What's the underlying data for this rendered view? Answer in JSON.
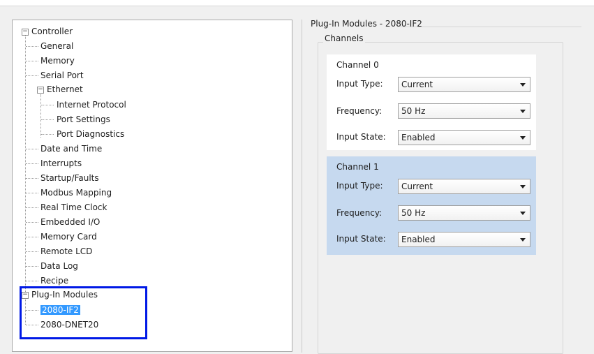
{
  "tree": {
    "controller": "Controller",
    "controller_children": [
      "General",
      "Memory",
      "Serial Port"
    ],
    "ethernet": "Ethernet",
    "ethernet_children": [
      "Internet Protocol",
      "Port Settings",
      "Port Diagnostics"
    ],
    "controller_rest": [
      "Date and Time",
      "Interrupts",
      "Startup/Faults",
      "Modbus Mapping",
      "Real Time Clock",
      "Embedded I/O",
      "Memory Card",
      "Remote LCD",
      "Data Log",
      "Recipe"
    ],
    "plugin_modules": "Plug-In Modules",
    "plugin_children": [
      "2080-IF2",
      "2080-DNET20"
    ]
  },
  "panel": {
    "title": "Plug-In Modules - 2080-IF2",
    "group_title": "Channels",
    "channels": [
      {
        "name": "Channel 0",
        "input_type_label": "Input Type:",
        "input_type": "Current",
        "frequency_label": "Frequency:",
        "frequency": "50 Hz",
        "input_state_label": "Input State:",
        "input_state": "Enabled"
      },
      {
        "name": "Channel 1",
        "input_type_label": "Input Type:",
        "input_type": "Current",
        "frequency_label": "Frequency:",
        "frequency": "50 Hz",
        "input_state_label": "Input State:",
        "input_state": "Enabled"
      }
    ]
  },
  "colors": {
    "selection": "#3399ff",
    "highlight_box": "#0019e6",
    "channel1_bg": "#c6d9ef"
  }
}
